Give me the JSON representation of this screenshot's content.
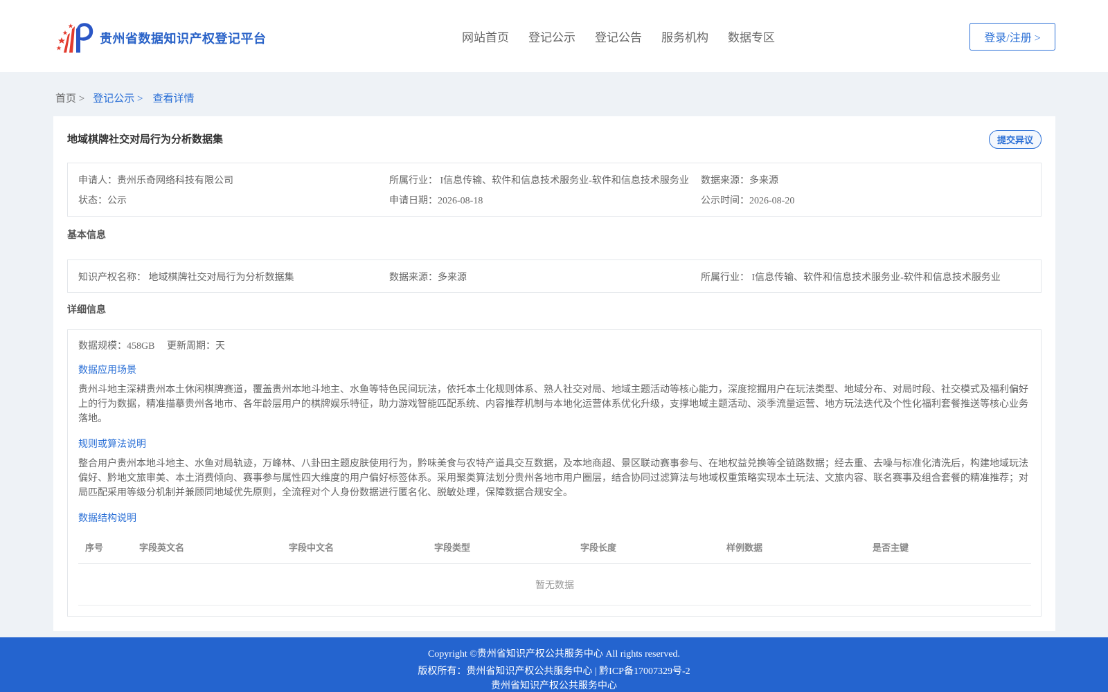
{
  "header": {
    "site_title": "贵州省数据知识产权登记平台",
    "nav": [
      "网站首页",
      "登记公示",
      "登记公告",
      "服务机构",
      "数据专区"
    ],
    "login_label": "登录/注册 >",
    "logo_icon": "flag-stars-logo-icon"
  },
  "breadcrumb": {
    "home": "首页 >",
    "parent": "登记公示 >",
    "current": "查看详情"
  },
  "record": {
    "title": "地域棋牌社交对局行为分析数据集",
    "objection_label": "提交异议",
    "applicant": "申请人：贵州乐奇网络科技有限公司",
    "industry": "所属行业： I信息传输、软件和信息技术服务业-软件和信息技术服务业",
    "data_source": "数据来源：多来源",
    "status": "状态：公示",
    "apply_date": "申请日期：2026-08-18",
    "publish_date": "公示时间：2026-08-20"
  },
  "basic_info": {
    "section_title": "基本信息",
    "ip_name": "知识产权名称： 地域棋牌社交对局行为分析数据集",
    "data_source": "数据来源：多来源",
    "industry": "所属行业： I信息传输、软件和信息技术服务业-软件和信息技术服务业"
  },
  "detail_info": {
    "section_title": "详细信息",
    "scale": "数据规模：458GB",
    "update_cycle": "更新周期：天",
    "scenario_title": "数据应用场景",
    "scenario_text": "贵州斗地主深耕贵州本土休闲棋牌赛道，覆盖贵州本地斗地主、水鱼等特色民间玩法，依托本土化规则体系、熟人社交对局、地域主题活动等核心能力，深度挖掘用户在玩法类型、地域分布、对局时段、社交模式及福利偏好上的行为数据，精准描摹贵州各地市、各年龄层用户的棋牌娱乐特征，助力游戏智能匹配系统、内容推荐机制与本地化运营体系优化升级，支撑地域主题活动、淡季流量运营、地方玩法迭代及个性化福利套餐推送等核心业务落地。",
    "rules_title": "规则或算法说明",
    "rules_text": "整合用户贵州本地斗地主、水鱼对局轨迹，万峰林、八卦田主题皮肤使用行为，黔味美食与农特产道具交互数据，及本地商超、景区联动赛事参与、在地权益兑换等全链路数据；经去重、去噪与标准化清洗后，构建地域玩法偏好、黔地文旅审美、本土消费倾向、赛事参与属性四大维度的用户偏好标签体系。采用聚类算法划分贵州各地市用户圈层，结合协同过滤算法与地域权重策略实现本土玩法、文旅内容、联名赛事及组合套餐的精准推荐；对局匹配采用等级分机制并兼顾同地域优先原则，全流程对个人身份数据进行匿名化、脱敏处理，保障数据合规安全。",
    "structure_title": "数据结构说明",
    "table_headers": [
      "序号",
      "字段英文名",
      "字段中文名",
      "字段类型",
      "字段长度",
      "样例数据",
      "是否主键"
    ],
    "empty_text": "暂无数据"
  },
  "footer": {
    "copyright": "Copyright ©贵州省知识产权公共服务中心 All rights reserved.",
    "owner": "版权所有：贵州省知识产权公共服务中心 | 黔ICP备17007329号-2",
    "org": "贵州省知识产权公共服务中心"
  }
}
